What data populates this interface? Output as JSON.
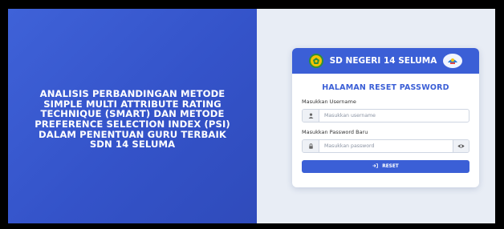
{
  "left": {
    "title": "ANALISIS PERBANDINGAN METODE SIMPLE MULTI ATTRIBUTE RATING TECHNIQUE (SMART) DAN METODE PREFERENCE SELECTION INDEX (PSI) DALAM PENENTUAN GURU TERBAIK SDN 14 SELUMA"
  },
  "card": {
    "school_name": "SD NEGERI 14 SELUMA",
    "title": "HALAMAN RESET PASSWORD",
    "username_label": "Masukkan Username",
    "username_placeholder": "Masukkan username",
    "password_label": "Masukkan Password Baru",
    "password_placeholder": "Masukkan password",
    "reset_label": "RESET"
  },
  "icons": {
    "school_logo": "school-badge-icon",
    "ministry_logo": "tut-wuri-handayani-icon",
    "user": "user-icon",
    "lock": "lock-icon",
    "eye": "eye-icon",
    "reset": "sign-in-icon"
  },
  "colors": {
    "primary": "#3b5fd6",
    "left_panel": "#3453c9",
    "right_panel": "#e8edf5"
  }
}
